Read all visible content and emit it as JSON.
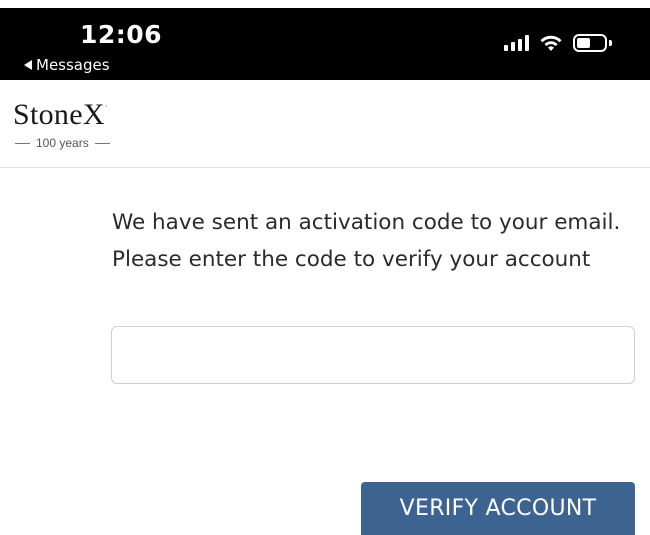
{
  "status_bar": {
    "time": "12:06",
    "back_label": "Messages"
  },
  "brand": {
    "name": "StoneX",
    "trademark": "·",
    "tagline": "100 years"
  },
  "verification": {
    "message": "We have sent an activation code to your email. Please enter the code to verify your account",
    "code_value": "",
    "code_placeholder": ""
  },
  "actions": {
    "verify_label": "VERIFY ACCOUNT"
  },
  "colors": {
    "status_bar_bg": "#000000",
    "primary_button": "#3d6390",
    "text": "#2b2b2b"
  }
}
